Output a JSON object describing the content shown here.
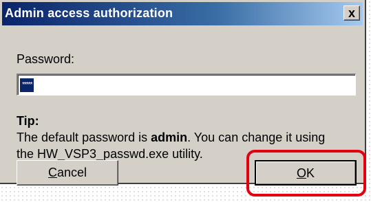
{
  "window": {
    "title": "Admin access authorization",
    "close_glyph": "x"
  },
  "password": {
    "label": "Password:",
    "value": "*****"
  },
  "tip": {
    "label": "Tip:",
    "text_before": "The default password is ",
    "bold_word": "admin",
    "text_after": ". You can change it using the HW_VSP3_passwd.exe utility."
  },
  "buttons": {
    "cancel_mnemonic": "C",
    "cancel_rest": "ancel",
    "ok_mnemonic": "O",
    "ok_rest": "K"
  },
  "colors": {
    "titlebar": "#0a246a",
    "dialog_bg": "#d4d0c8",
    "highlight": "#e3000f"
  }
}
